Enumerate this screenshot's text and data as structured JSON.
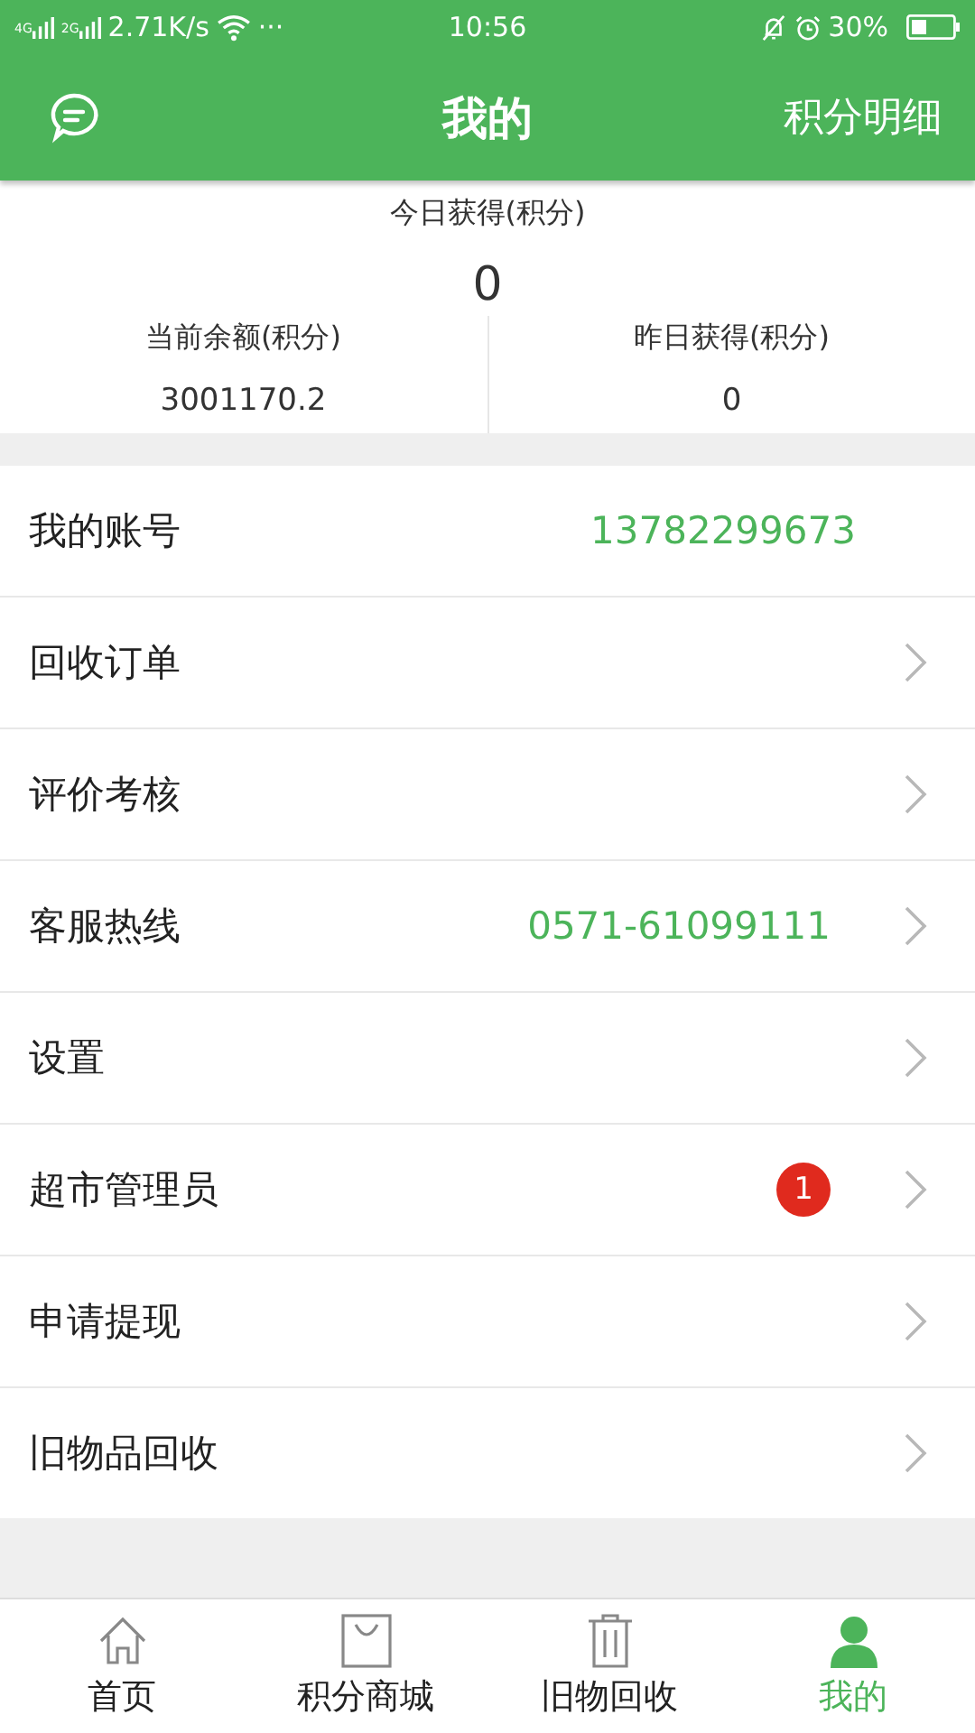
{
  "status_bar": {
    "net1": "4G",
    "net2": "2G",
    "speed": "2.71K/s",
    "more": "···",
    "time": "10:56",
    "battery": "30%"
  },
  "header": {
    "title": "我的",
    "action": "积分明细"
  },
  "summary": {
    "today_label": "今日获得(积分)",
    "today_value": "0",
    "stats": [
      {
        "label": "当前余额(积分)",
        "value": "3001170.2"
      },
      {
        "label": "昨日获得(积分)",
        "value": "0"
      }
    ]
  },
  "menu": [
    {
      "label": "我的账号",
      "value": "13782299673",
      "arrow": false
    },
    {
      "label": "回收订单",
      "arrow": true
    },
    {
      "label": "评价考核",
      "arrow": true
    },
    {
      "label": "客服热线",
      "value": "0571-61099111",
      "arrow": true
    },
    {
      "label": "设置",
      "arrow": true
    },
    {
      "label": "超市管理员",
      "badge": "1",
      "arrow": true
    },
    {
      "label": "申请提现",
      "arrow": true
    },
    {
      "label": "旧物品回收",
      "arrow": true
    }
  ],
  "tabs": [
    {
      "kind": "home",
      "label": "首页",
      "selected": false
    },
    {
      "kind": "bag",
      "label": "积分商城",
      "selected": false
    },
    {
      "kind": "trash",
      "label": "旧物回收",
      "selected": false
    },
    {
      "kind": "person",
      "label": "我的",
      "selected": true
    }
  ]
}
